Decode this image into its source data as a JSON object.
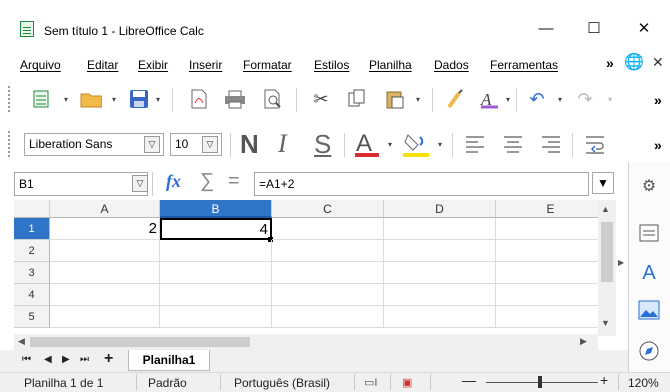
{
  "window": {
    "title": "Sem título 1 - LibreOffice Calc",
    "minimize": "—",
    "maximize": "☐",
    "close": "✕"
  },
  "menu": [
    "Arquivo",
    "Editar",
    "Exibir",
    "Inserir",
    "Formatar",
    "Estilos",
    "Planilha",
    "Dados",
    "Ferramentas"
  ],
  "menu_overflow": "»",
  "toolbar": {
    "font_name": "Liberation Sans",
    "font_size": "10",
    "overflow": "»"
  },
  "formula_bar": {
    "cell_ref": "B1",
    "formula": "=A1+2",
    "fx_label": "fx",
    "sum_label": "∑",
    "equal_label": "="
  },
  "sheet": {
    "columns": [
      "A",
      "B",
      "C",
      "D",
      "E"
    ],
    "rows": [
      "1",
      "2",
      "3",
      "4",
      "5"
    ],
    "cells": {
      "A1": "2",
      "B1": "4"
    },
    "tab_name": "Planilha1"
  },
  "status": {
    "sheet_pos": "Planilha 1 de 1",
    "page_style": "Padrão",
    "language": "Português (Brasil)",
    "zoom": "120%"
  },
  "colors": {
    "selected_header": "#2f76c9",
    "accent_red": "#d92b2b",
    "accent_blue": "#2a6fd6"
  }
}
